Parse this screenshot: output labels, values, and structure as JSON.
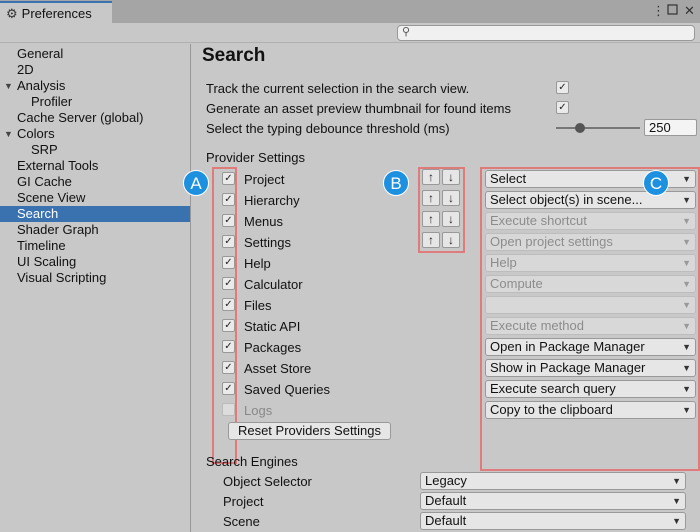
{
  "window": {
    "tab_title": "Preferences",
    "tab_icon": "gear-icon",
    "menu_icon": "kebab-menu-icon",
    "restore_icon": "restore-icon",
    "close_icon": "close-icon"
  },
  "toolbar": {
    "search_placeholder": "",
    "search_value": ""
  },
  "sidebar": {
    "items": [
      {
        "label": "General",
        "indent": 0,
        "active": false
      },
      {
        "label": "2D",
        "indent": 0,
        "active": false
      },
      {
        "label": "Analysis",
        "indent": 0,
        "expanded": true,
        "active": false
      },
      {
        "label": "Profiler",
        "indent": 1,
        "active": false
      },
      {
        "label": "Cache Server (global)",
        "indent": 0,
        "active": false
      },
      {
        "label": "Colors",
        "indent": 0,
        "expanded": true,
        "active": false
      },
      {
        "label": "SRP",
        "indent": 1,
        "active": false
      },
      {
        "label": "External Tools",
        "indent": 0,
        "active": false
      },
      {
        "label": "GI Cache",
        "indent": 0,
        "active": false
      },
      {
        "label": "Scene View",
        "indent": 0,
        "active": false
      },
      {
        "label": "Search",
        "indent": 0,
        "active": true
      },
      {
        "label": "Shader Graph",
        "indent": 0,
        "active": false
      },
      {
        "label": "Timeline",
        "indent": 0,
        "active": false
      },
      {
        "label": "UI Scaling",
        "indent": 0,
        "active": false
      },
      {
        "label": "Visual Scripting",
        "indent": 0,
        "active": false
      }
    ]
  },
  "main": {
    "title": "Search",
    "options": [
      {
        "label": "Track the current selection in the search view.",
        "checked": true
      },
      {
        "label": "Generate an asset preview thumbnail for found items",
        "checked": true
      },
      {
        "label": "Select the typing debounce threshold (ms)",
        "value": "250",
        "slider_fraction": 0.25
      }
    ],
    "provider_settings_header": "Provider Settings",
    "providers": [
      {
        "label": "Project",
        "checked": true,
        "enabled": true,
        "has_order": true,
        "action": "Select",
        "action_enabled": true
      },
      {
        "label": "Hierarchy",
        "checked": true,
        "enabled": true,
        "has_order": true,
        "action": "Select object(s) in scene...",
        "action_enabled": true
      },
      {
        "label": "Menus",
        "checked": true,
        "enabled": true,
        "has_order": true,
        "action": "Execute shortcut",
        "action_enabled": false
      },
      {
        "label": "Settings",
        "checked": true,
        "enabled": true,
        "has_order": true,
        "action": "Open project settings",
        "action_enabled": false
      },
      {
        "label": "Help",
        "checked": true,
        "enabled": true,
        "has_order": false,
        "action": "Help",
        "action_enabled": false
      },
      {
        "label": "Calculator",
        "checked": true,
        "enabled": true,
        "has_order": false,
        "action": "Compute",
        "action_enabled": false
      },
      {
        "label": "Files",
        "checked": true,
        "enabled": true,
        "has_order": false,
        "action": "",
        "action_enabled": false
      },
      {
        "label": "Static API",
        "checked": true,
        "enabled": true,
        "has_order": false,
        "action": "Execute method",
        "action_enabled": false
      },
      {
        "label": "Packages",
        "checked": true,
        "enabled": true,
        "has_order": false,
        "action": "Open in Package Manager",
        "action_enabled": true
      },
      {
        "label": "Asset Store",
        "checked": true,
        "enabled": true,
        "has_order": false,
        "action": "Show in Package Manager",
        "action_enabled": true
      },
      {
        "label": "Saved Queries",
        "checked": true,
        "enabled": true,
        "has_order": false,
        "action": "Execute search query",
        "action_enabled": true
      },
      {
        "label": "Logs",
        "checked": false,
        "enabled": false,
        "has_order": false,
        "action": "Copy to the clipboard",
        "action_enabled": true
      }
    ],
    "order_up_glyph": "↑",
    "order_down_glyph": "↓",
    "reset_button": "Reset Providers Settings",
    "markers": {
      "a": "A",
      "b": "B",
      "c": "C"
    },
    "search_engines_header": "Search Engines",
    "engines": [
      {
        "label": "Object Selector",
        "value": "Legacy"
      },
      {
        "label": "Project",
        "value": "Default"
      },
      {
        "label": "Scene",
        "value": "Default"
      }
    ],
    "accent_color": "#3a72b0",
    "marker_color": "#1e90e0",
    "highlight_box_color": "#e07b7b"
  }
}
